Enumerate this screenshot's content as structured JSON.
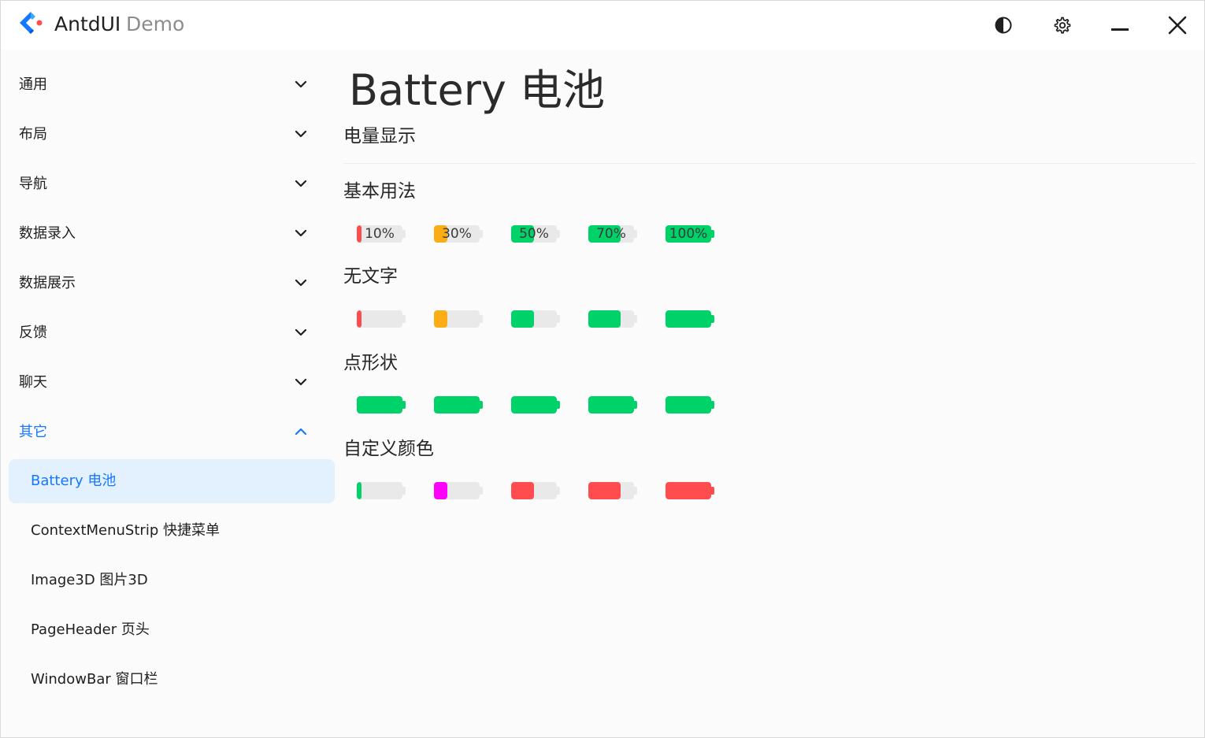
{
  "app": {
    "title": "AntdUI",
    "subtitle": "Demo"
  },
  "titlebar": {
    "buttons": [
      {
        "name": "theme-toggle-button",
        "icon": "contrast-icon"
      },
      {
        "name": "settings-button",
        "icon": "gear-icon"
      },
      {
        "name": "minimize-button",
        "icon": "minimize-icon"
      },
      {
        "name": "close-button",
        "icon": "close-icon"
      }
    ]
  },
  "sidebar": {
    "items": [
      {
        "label": "通用",
        "expanded": false
      },
      {
        "label": "布局",
        "expanded": false
      },
      {
        "label": "导航",
        "expanded": false
      },
      {
        "label": "数据录入",
        "expanded": false
      },
      {
        "label": "数据展示",
        "expanded": false
      },
      {
        "label": "反馈",
        "expanded": false
      },
      {
        "label": "聊天",
        "expanded": false
      },
      {
        "label": "其它",
        "expanded": true
      }
    ],
    "sub_items": [
      {
        "label": "Battery 电池",
        "active": true
      },
      {
        "label": "ContextMenuStrip 快捷菜单",
        "active": false
      },
      {
        "label": "Image3D 图片3D",
        "active": false
      },
      {
        "label": "PageHeader 页头",
        "active": false
      },
      {
        "label": "WindowBar 窗口栏",
        "active": false
      }
    ]
  },
  "page": {
    "title": "Battery 电池",
    "section": "电量显示",
    "groups": [
      {
        "title": "基本用法",
        "show_text": true,
        "batteries": [
          {
            "level": 0.1,
            "text": "10%",
            "color": "#ff4d4f"
          },
          {
            "level": 0.3,
            "text": "30%",
            "color": "#faad14"
          },
          {
            "level": 0.5,
            "text": "50%",
            "color": "#00d26a"
          },
          {
            "level": 0.7,
            "text": "70%",
            "color": "#00d26a"
          },
          {
            "level": 1.0,
            "text": "100%",
            "color": "#00d26a"
          }
        ]
      },
      {
        "title": "无文字",
        "show_text": false,
        "batteries": [
          {
            "level": 0.1,
            "color": "#ff4d4f"
          },
          {
            "level": 0.3,
            "color": "#faad14"
          },
          {
            "level": 0.5,
            "color": "#00d26a"
          },
          {
            "level": 0.7,
            "color": "#00d26a"
          },
          {
            "level": 1.0,
            "color": "#00d26a"
          }
        ]
      },
      {
        "title": "点形状",
        "show_text": false,
        "batteries": [
          {
            "level": 1.0,
            "color": "#00d26a"
          },
          {
            "level": 1.0,
            "color": "#00d26a"
          },
          {
            "level": 1.0,
            "color": "#00d26a"
          },
          {
            "level": 1.0,
            "color": "#00d26a"
          },
          {
            "level": 1.0,
            "color": "#00d26a"
          }
        ]
      },
      {
        "title": "自定义颜色",
        "show_text": false,
        "batteries": [
          {
            "level": 0.1,
            "color": "#00d26a"
          },
          {
            "level": 0.3,
            "color": "#ff00ff"
          },
          {
            "level": 0.5,
            "color": "#ff4d4f"
          },
          {
            "level": 0.7,
            "color": "#ff4d4f"
          },
          {
            "level": 1.0,
            "color": "#ff4d4f"
          }
        ]
      }
    ]
  },
  "colors": {
    "accent": "#1677ff",
    "active_background": "#e3f0fe",
    "battery_track": "#e9e9ea"
  }
}
